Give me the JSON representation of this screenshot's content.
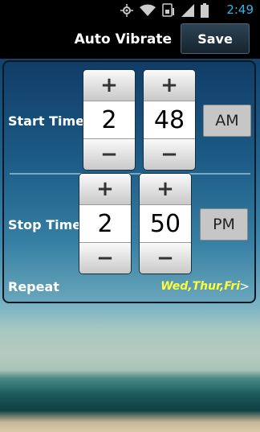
{
  "status_bar": {
    "time": "2:49",
    "icons": [
      "gps-icon",
      "wifi-icon",
      "sim-icon",
      "signal-icon",
      "battery-icon"
    ]
  },
  "header": {
    "title": "Auto Vibrate",
    "save_label": "Save"
  },
  "start_time": {
    "label": "Start Time",
    "hour": "2",
    "minute": "48",
    "meridiem": "AM",
    "increment": "+",
    "decrement": "−"
  },
  "stop_time": {
    "label": "Stop Time",
    "hour": "2",
    "minute": "50",
    "meridiem": "PM",
    "increment": "+",
    "decrement": "−"
  },
  "repeat": {
    "label": "Repeat",
    "value": "Wed,Thur,Fri",
    "chevron": ">"
  },
  "colors": {
    "clock": "#34b5e5",
    "repeat_value": "#ffff3a",
    "header_bg": "#000000"
  }
}
